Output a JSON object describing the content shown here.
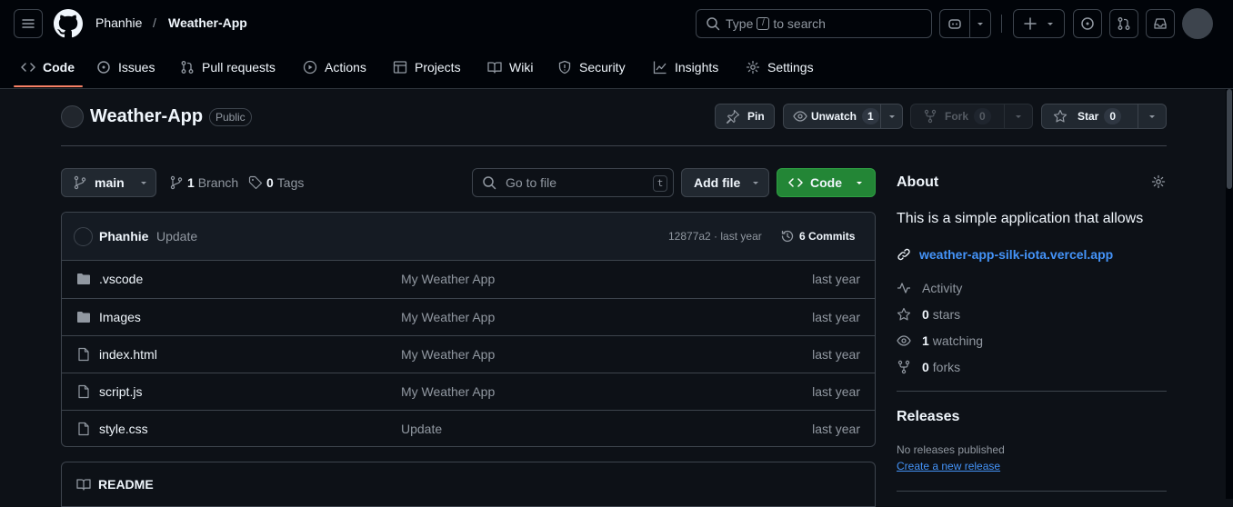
{
  "header": {
    "owner": "Phanhie",
    "separator": "/",
    "repo": "Weather-App",
    "search_prefix": "Type",
    "search_key": "/",
    "search_suffix": "to search"
  },
  "nav": {
    "tabs": [
      {
        "label": "Code",
        "icon": "code-icon"
      },
      {
        "label": "Issues",
        "icon": "issue-icon"
      },
      {
        "label": "Pull requests",
        "icon": "pull-request-icon"
      },
      {
        "label": "Actions",
        "icon": "play-icon"
      },
      {
        "label": "Projects",
        "icon": "table-icon"
      },
      {
        "label": "Wiki",
        "icon": "book-icon"
      },
      {
        "label": "Security",
        "icon": "shield-icon"
      },
      {
        "label": "Insights",
        "icon": "graph-icon"
      },
      {
        "label": "Settings",
        "icon": "gear-icon"
      }
    ],
    "active_color": "#f78166"
  },
  "repo": {
    "name": "Weather-App",
    "visibility": "Public",
    "pin_label": "Pin",
    "unwatch_label": "Unwatch",
    "unwatch_count": "1",
    "fork_label": "Fork",
    "fork_count": "0",
    "star_label": "Star",
    "star_count": "0"
  },
  "toolbar": {
    "branch": "main",
    "branch_count": "1",
    "branch_label": "Branch",
    "tag_count": "0",
    "tag_label": "Tags",
    "goto_placeholder": "Go to file",
    "goto_key": "t",
    "add_file_label": "Add file",
    "code_label": "Code",
    "code_color": "#238636"
  },
  "commit": {
    "author": "Phanhie",
    "message": "Update",
    "hash_time": "12877a2 · last year",
    "commits_count": "6",
    "commits_label": "Commits"
  },
  "files": [
    {
      "name": ".vscode",
      "type": "folder",
      "message": "My Weather App",
      "time": "last year"
    },
    {
      "name": "Images",
      "type": "folder",
      "message": "My Weather App",
      "time": "last year"
    },
    {
      "name": "index.html",
      "type": "file",
      "message": "My Weather App",
      "time": "last year"
    },
    {
      "name": "script.js",
      "type": "file",
      "message": "My Weather App",
      "time": "last year"
    },
    {
      "name": "style.css",
      "type": "file",
      "message": "Update",
      "time": "last year"
    }
  ],
  "readme": {
    "label": "README"
  },
  "about": {
    "title": "About",
    "description": "This is a simple application that allows",
    "url": "weather-app-silk-iota.vercel.app",
    "activity": "Activity",
    "stars_count": "0",
    "stars_label": "stars",
    "watching_count": "1",
    "watching_label": "watching",
    "forks_count": "0",
    "forks_label": "forks"
  },
  "releases": {
    "title": "Releases",
    "none": "No releases published",
    "create": "Create a new release"
  }
}
